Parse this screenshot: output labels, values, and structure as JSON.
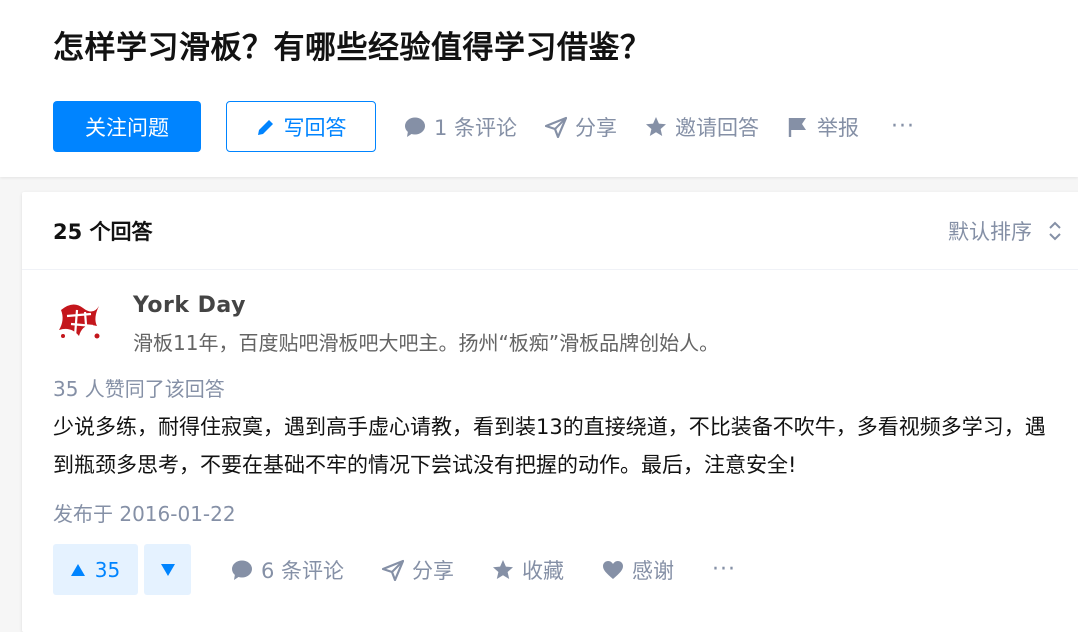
{
  "question": {
    "title": "怎样学习滑板？有哪些经验值得学习借鉴？",
    "follow_label": "关注问题",
    "write_label": "写回答",
    "comments_label": "1 条评论",
    "share_label": "分享",
    "invite_label": "邀请回答",
    "report_label": "举报",
    "more_label": "···"
  },
  "answers": {
    "count_label": "25 个回答",
    "sort_label": "默认排序"
  },
  "answer": {
    "author_name": "York Day",
    "author_bio": "滑板11年，百度贴吧滑板吧大吧主。扬州“板痴”滑板品牌创始人。",
    "votes_text": "35 人赞同了该回答",
    "content": "少说多练，耐得住寂寞，遇到高手虚心请教，看到装13的直接绕道，不比装备不吹牛，多看视频多学习，遇到瓶颈多思考，不要在基础不牢的情况下尝试没有把握的动作。最后，注意安全!",
    "date": "发布于 2016-01-22",
    "upvote_count": "35",
    "comments_label": "6 条评论",
    "share_label": "分享",
    "collect_label": "收藏",
    "thanks_label": "感谢",
    "more_label": "···"
  },
  "colors": {
    "accent": "#0084ff",
    "muted": "#8590a6",
    "text": "#121212",
    "background": "#f6f6f6"
  },
  "icons": [
    "pencil-icon",
    "comment-icon",
    "share-icon",
    "star-icon",
    "flag-icon",
    "sort-icon",
    "triangle-up-icon",
    "triangle-down-icon",
    "heart-icon"
  ]
}
